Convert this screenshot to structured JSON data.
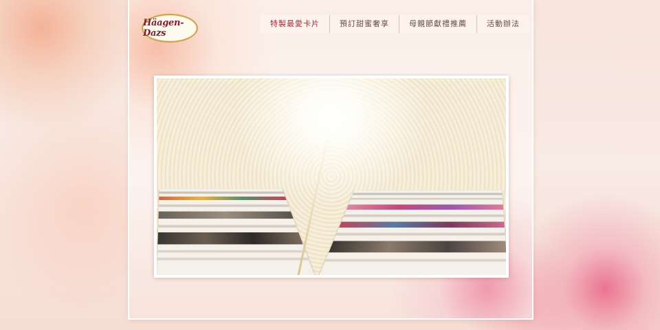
{
  "brand": {
    "logo_text": "Häagen-Dazs"
  },
  "nav": {
    "items": [
      {
        "label": "特製最愛卡片",
        "active": true
      },
      {
        "label": "預訂甜蜜奢享",
        "active": false
      },
      {
        "label": "母親節獻禮推薦",
        "active": false
      },
      {
        "label": "活動辦法",
        "active": false
      }
    ]
  },
  "colors": {
    "accent": "#a52a3a",
    "nav_text": "#6a4a44",
    "frame_gold": "#c9a54f"
  }
}
